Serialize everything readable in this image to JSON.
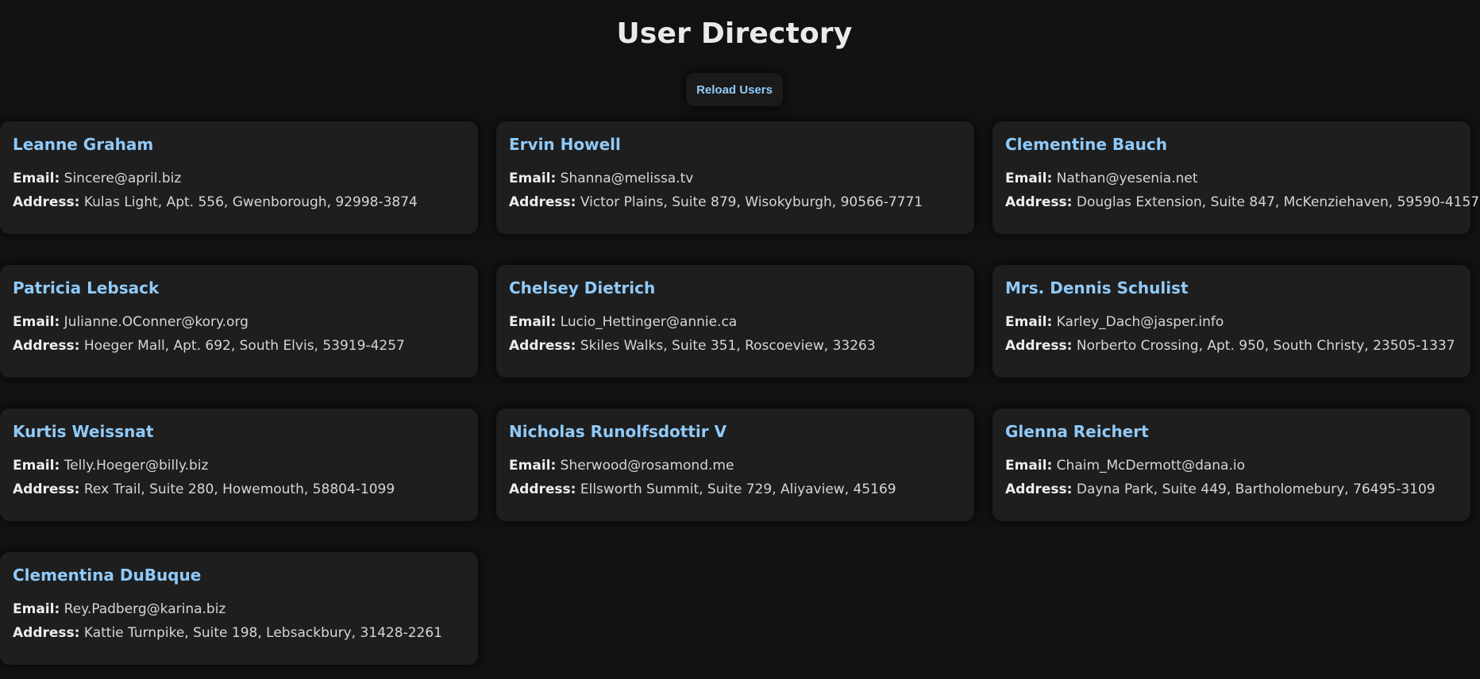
{
  "page": {
    "title": "User Directory",
    "reload_label": "Reload Users",
    "email_label": "Email:",
    "address_label": "Address:"
  },
  "colors": {
    "background": "#121212",
    "card": "#1e1e1e",
    "accent": "#90caf9",
    "text": "#d6d6d6"
  },
  "users": [
    {
      "name": "Leanne Graham",
      "email": "Sincere@april.biz",
      "address": "Kulas Light, Apt. 556, Gwenborough, 92998-3874"
    },
    {
      "name": "Ervin Howell",
      "email": "Shanna@melissa.tv",
      "address": "Victor Plains, Suite 879, Wisokyburgh, 90566-7771"
    },
    {
      "name": "Clementine Bauch",
      "email": "Nathan@yesenia.net",
      "address": "Douglas Extension, Suite 847, McKenziehaven, 59590-4157"
    },
    {
      "name": "Patricia Lebsack",
      "email": "Julianne.OConner@kory.org",
      "address": "Hoeger Mall, Apt. 692, South Elvis, 53919-4257"
    },
    {
      "name": "Chelsey Dietrich",
      "email": "Lucio_Hettinger@annie.ca",
      "address": "Skiles Walks, Suite 351, Roscoeview, 33263"
    },
    {
      "name": "Mrs. Dennis Schulist",
      "email": "Karley_Dach@jasper.info",
      "address": "Norberto Crossing, Apt. 950, South Christy, 23505-1337"
    },
    {
      "name": "Kurtis Weissnat",
      "email": "Telly.Hoeger@billy.biz",
      "address": "Rex Trail, Suite 280, Howemouth, 58804-1099"
    },
    {
      "name": "Nicholas Runolfsdottir V",
      "email": "Sherwood@rosamond.me",
      "address": "Ellsworth Summit, Suite 729, Aliyaview, 45169"
    },
    {
      "name": "Glenna Reichert",
      "email": "Chaim_McDermott@dana.io",
      "address": "Dayna Park, Suite 449, Bartholomebury, 76495-3109"
    },
    {
      "name": "Clementina DuBuque",
      "email": "Rey.Padberg@karina.biz",
      "address": "Kattie Turnpike, Suite 198, Lebsackbury, 31428-2261"
    }
  ]
}
